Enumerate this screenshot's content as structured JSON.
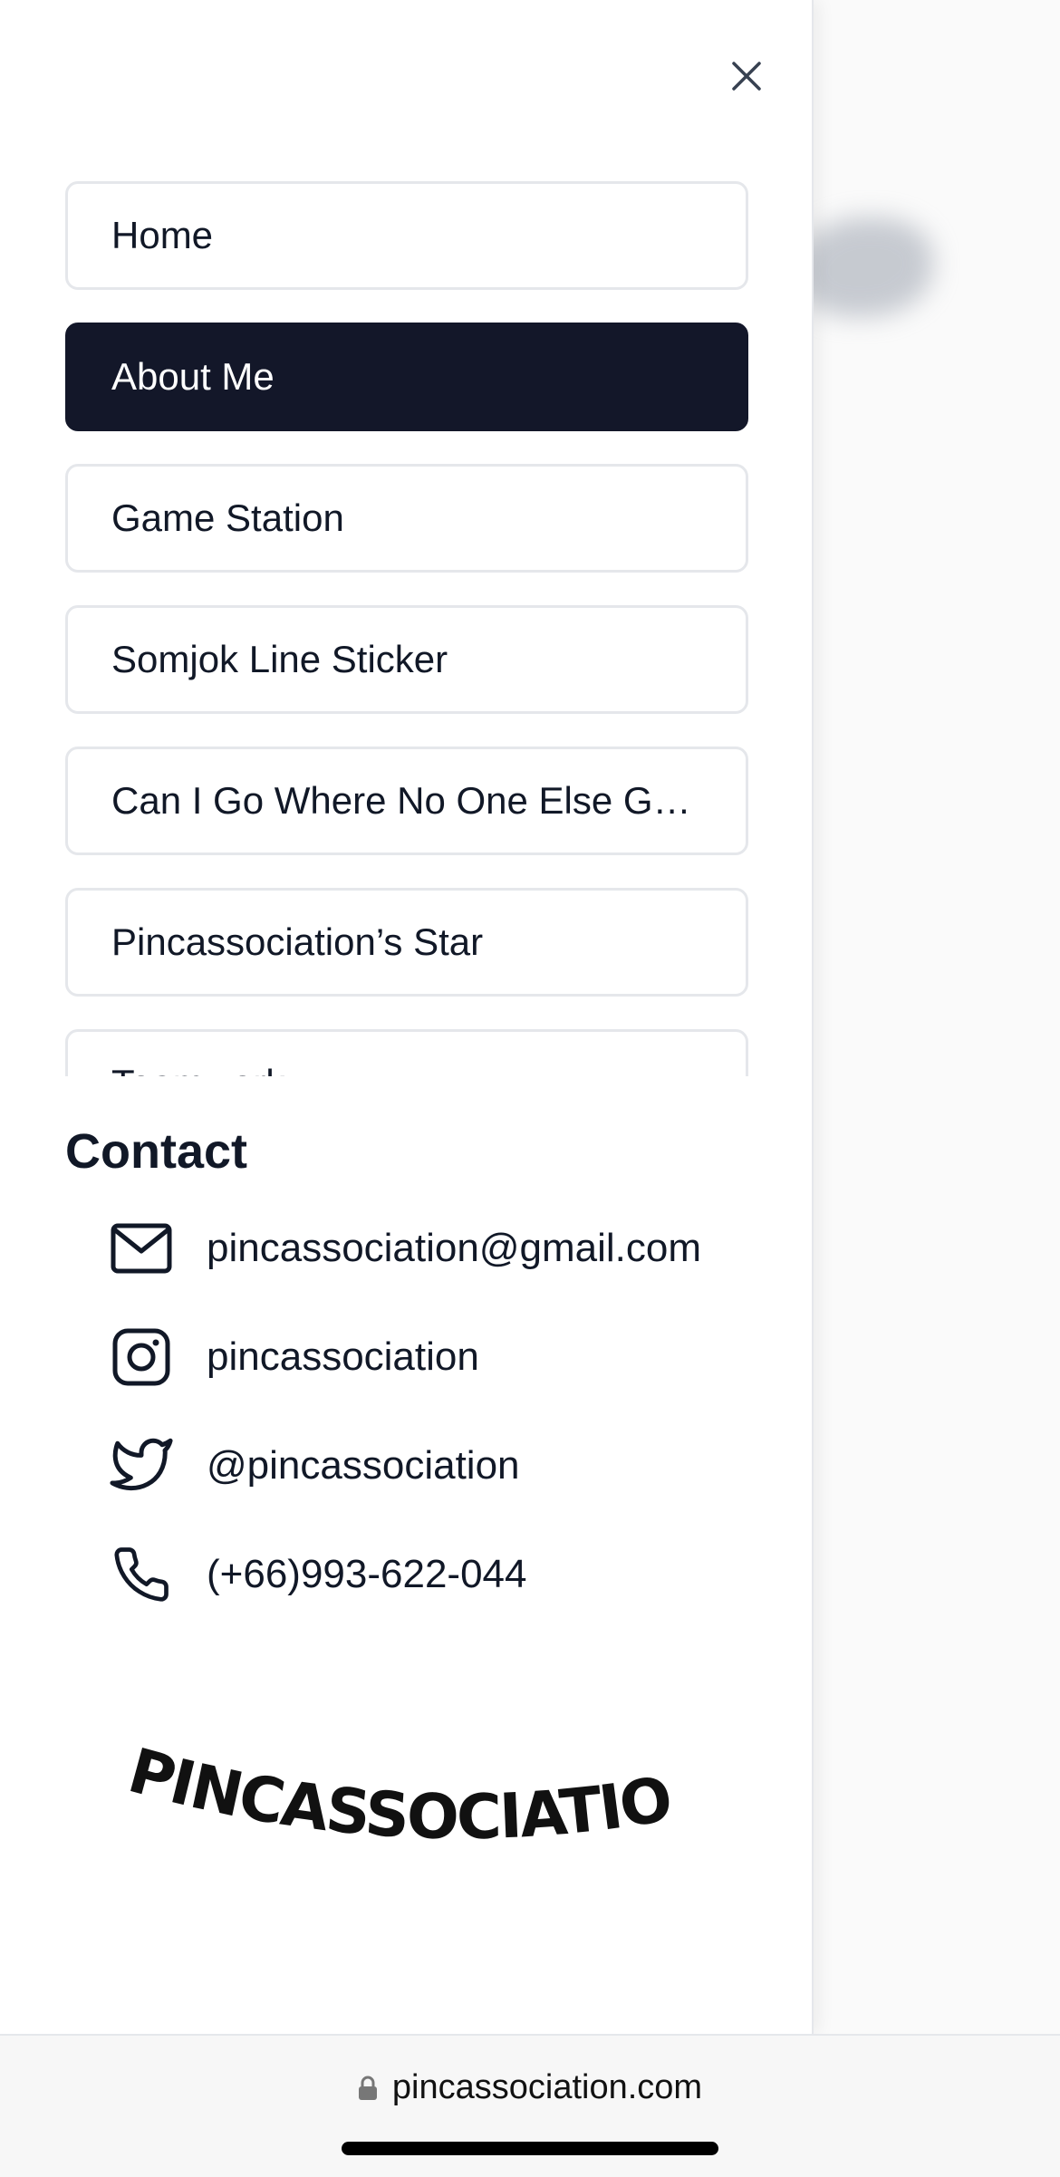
{
  "nav": {
    "items": [
      {
        "label": "Home",
        "active": false
      },
      {
        "label": "About Me",
        "active": true
      },
      {
        "label": "Game Station",
        "active": false
      },
      {
        "label": "Somjok Line Sticker",
        "active": false
      },
      {
        "label": "Can I Go Where No One Else Goes",
        "active": false
      },
      {
        "label": "Pincassociation’s Star",
        "active": false
      },
      {
        "label": "Teamwork",
        "active": false
      }
    ]
  },
  "contact": {
    "title": "Contact",
    "items": [
      {
        "icon": "mail-icon",
        "text": "pincassociation@gmail.com"
      },
      {
        "icon": "instagram-icon",
        "text": "pincassociation"
      },
      {
        "icon": "twitter-icon",
        "text": "@pincassociation"
      },
      {
        "icon": "phone-icon",
        "text": "(+66)993-622-044"
      }
    ]
  },
  "logo": {
    "text": "PINCASSOCIATION"
  },
  "browser": {
    "url": "pincassociation.com"
  },
  "colors": {
    "active_bg": "#131729",
    "border": "#e5e7eb",
    "text": "#111827"
  }
}
